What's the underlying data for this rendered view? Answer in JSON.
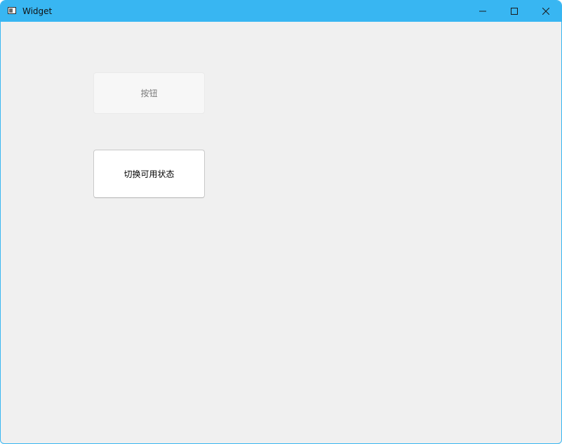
{
  "window": {
    "title": "Widget",
    "accent_color": "#38b6f2"
  },
  "titlebar": {
    "app_icon": "window-icon",
    "minimize_icon": "minimize-icon",
    "maximize_icon": "maximize-icon",
    "close_icon": "close-icon"
  },
  "content": {
    "button_label": "按钮",
    "button_state": "disabled",
    "toggle_label": "切换可用状态"
  }
}
